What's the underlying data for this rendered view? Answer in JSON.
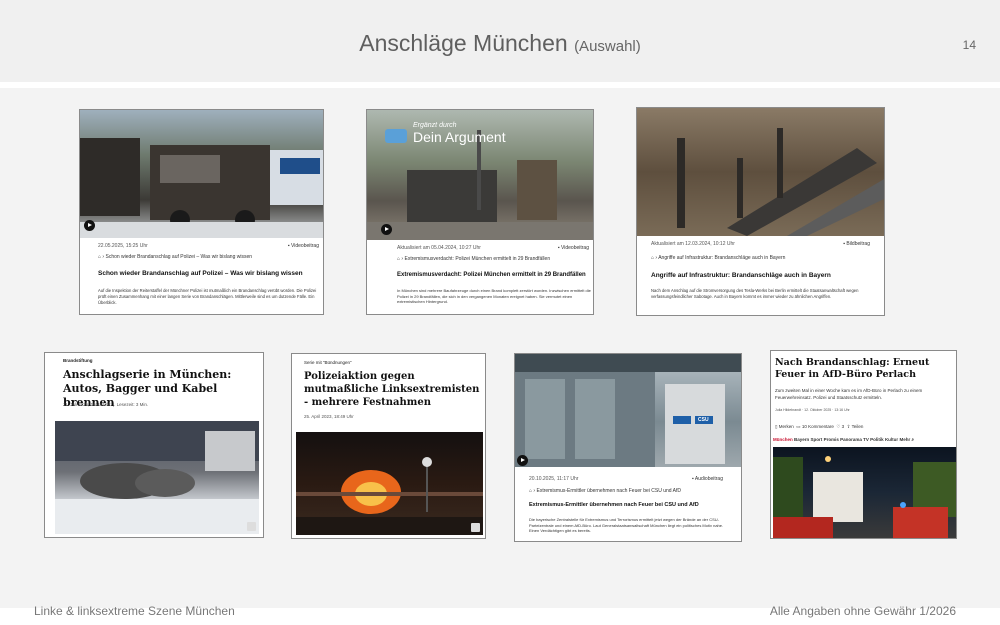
{
  "slide": {
    "title": "Anschläge München",
    "title_suffix": "(Auswahl)",
    "page_number": "14",
    "footer_left": "Linke & linksextreme Szene München",
    "footer_right": "Alle Angaben ohne Gewähr 1/2026"
  },
  "cards": {
    "c1": {
      "date": "22.05.2025, 15:25 Uhr",
      "video_label": "Videobeitrag",
      "breadcrumb": "Schon wieder Brandanschlag auf Polizei – Was wir bislang wissen",
      "headline": "Schon wieder Brandanschlag auf Polizei – Was wir bislang wissen",
      "body": "Auf die Inspektion der Reiterstaffel der Münchner Polizei ist mutmaßlich ein Brandanschlag verübt worden. Die Polizei prüft einen Zusammenhang mit einer langen Serie von Brandanschlägen. Mittlerweile sind es um dutzende Fälle. Ein Überblick."
    },
    "c2": {
      "overlay_small": "Ergänzt durch",
      "overlay_big": "Dein Argument",
      "date": "Aktualisiert am 05.04.2024, 10:27 Uhr",
      "video_label": "Videobeitrag",
      "breadcrumb": "Extremismusverdacht: Polizei München ermittelt in 29 Brandfällen",
      "headline": "Extremismusverdacht: Polizei München ermittelt in 29 Brandfällen",
      "body": "In München sind mehrere Baufahrzeuge durch einen Brand komplett zerstört worden. Inzwischen ermittelt die Polizei in 29 Brandfällen, die sich in den vergangenen Monaten ereignet haben. Sie vermutet einen extremistischen Hintergrund."
    },
    "c3": {
      "date": "Aktualisiert am 12.03.2024, 10:12 Uhr",
      "image_label": "Bildbeitrag",
      "breadcrumb": "Angriffe auf Infrastruktur: Brandanschläge auch in Bayern",
      "headline": "Angriffe auf Infrastruktur: Brandanschläge auch in Bayern",
      "body": "Nach dem Anschlag auf die Stromversorgung des Tesla-Werks bei Berlin ermittelt die Staatsanwaltschaft wegen verfassungsfeindlicher Sabotage. Auch in Bayern kommt es immer wieder zu ähnlichen Angriffen."
    },
    "c4": {
      "kicker": "Brandstiftung",
      "headline": "Anschlagserie in München: Autos, Bagger und Kabel brennen",
      "date": "11. Juli 2025, 16:48 Uhr",
      "read_time": "Lesezeit: 3 Min."
    },
    "c5": {
      "kicker": "Serie mit “Bündnungen”",
      "headline": "Polizeiaktion gegen mutmaßliche Linksextremisten - mehrere Festnahmen",
      "date": "25. April 2023, 18:49 Uhr"
    },
    "c6": {
      "date": "20.10.2025, 11:17 Uhr",
      "audio_label": "Audiobeitrag",
      "breadcrumb": "Extremismus-Ermittler übernehmen nach Feuer bei CSU und AfD",
      "headline": "Extremismus-Ermittler übernehmen nach Feuer bei CSU und AfD",
      "body": "Die bayerische Zentralstelle für Extremismus und Terrorismus ermittelt jetzt wegen der Brände an der CSU-Parteizentrale und einem AfD-Büro. Laut Generalstaatsanwaltschaft München liegt ein politisches Motiv nahe. Einen Verdächtigen gibt es bereits.",
      "sign_text": "CSU"
    },
    "c7": {
      "headline": "Nach Brandanschlag: Erneut Feuer in AfD-Büro Perlach",
      "teaser": "Zum zweiten Mal in einer Woche kam es im AfD-Büro in Perlach zu einem Feuerwehreinsatz. Polizei und Staatsschutz ermitteln.",
      "byline": "Julia Hildebrandt  · 12. Oktober 2025 · 13:16 Uhr",
      "actions": [
        "Merken",
        "10 Kommentare",
        "Teilen"
      ],
      "nav": [
        "Bayern",
        "Sport",
        "Promis",
        "Panorama",
        "TV",
        "Politik",
        "Kultur",
        "Mehr"
      ],
      "nav_accent": "München"
    }
  },
  "colors": {
    "header_bg": "#f0f0f0",
    "accent_red": "#c8102e",
    "title_gray": "#5f5f5f"
  }
}
